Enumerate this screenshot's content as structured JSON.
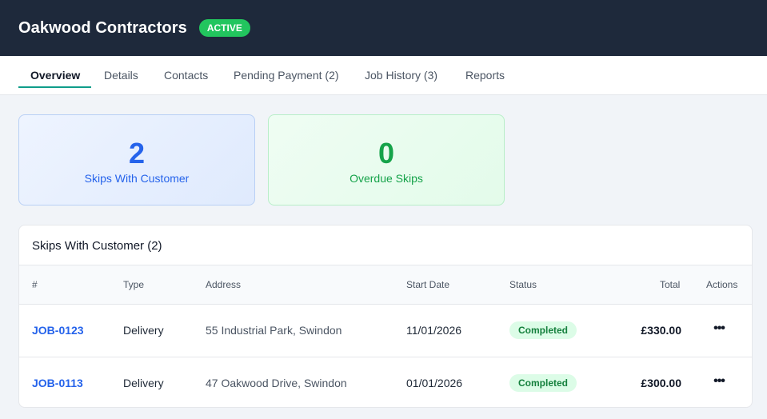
{
  "header": {
    "title": "Oakwood Contractors",
    "status_badge": "ACTIVE"
  },
  "tabs": [
    {
      "label": "Overview",
      "active": true
    },
    {
      "label": "Details"
    },
    {
      "label": "Contacts"
    },
    {
      "label": "Pending Payment (2)"
    },
    {
      "label": "Job History (3)"
    },
    {
      "label": "Reports"
    }
  ],
  "stats": [
    {
      "value": "2",
      "label": "Skips With Customer",
      "color": "#2563eb"
    },
    {
      "value": "0",
      "label": "Overdue Skips",
      "color": "#16a34a"
    }
  ],
  "skips_table": {
    "title": "Skips With Customer (2)",
    "columns": [
      "#",
      "Type",
      "Address",
      "Start Date",
      "Status",
      "Total",
      "Actions"
    ],
    "rows": [
      {
        "job": "JOB-0123",
        "type": "Delivery",
        "address": "55 Industrial Park, Swindon",
        "start_date": "11/01/2026",
        "status": "Completed",
        "total": "£330.00",
        "actions_icon": "more-horizontal-icon",
        "actions_glyph": "•••"
      },
      {
        "job": "JOB-0113",
        "type": "Delivery",
        "address": "47 Oakwood Drive, Swindon",
        "start_date": "01/01/2026",
        "status": "Completed",
        "total": "£300.00",
        "actions_icon": "more-horizontal-icon",
        "actions_glyph": "•••"
      }
    ]
  },
  "colors": {
    "header_bg": "#1e293b",
    "badge_green": "#22c55e",
    "tab_accent": "#0f9d8a",
    "link_blue": "#2563eb"
  }
}
